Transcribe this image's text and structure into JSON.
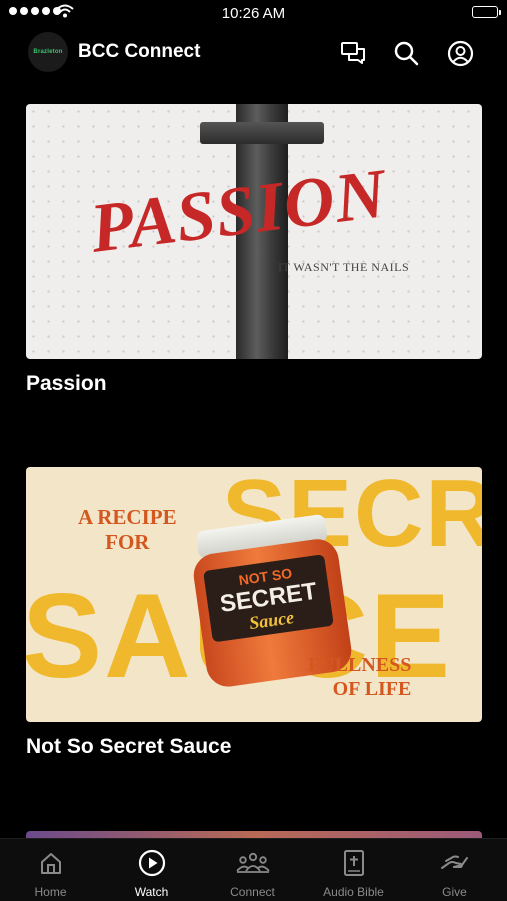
{
  "status_bar": {
    "time": "10:26 AM"
  },
  "header": {
    "app_title": "BCC Connect",
    "logo_text": "Brazleton"
  },
  "cards": [
    {
      "title": "Passion",
      "thumb_word": "PASSION",
      "thumb_subtitle": "IT WASN'T THE NAILS"
    },
    {
      "title": "Not So Secret Sauce",
      "thumb_line1": "A RECIPE",
      "thumb_line2": "FOR",
      "thumb_line3": "FULLNESS",
      "thumb_line4": "OF LIFE",
      "jar_line1": "NOT SO",
      "jar_line2": "SECRET",
      "jar_line3": "Sauce",
      "bg_word1": "SECRET",
      "bg_word2": "SAUCE"
    }
  ],
  "tabs": [
    {
      "label": "Home",
      "icon": "home-icon"
    },
    {
      "label": "Watch",
      "icon": "play-icon"
    },
    {
      "label": "Connect",
      "icon": "people-icon"
    },
    {
      "label": "Audio Bible",
      "icon": "bible-icon"
    },
    {
      "label": "Give",
      "icon": "give-icon"
    }
  ],
  "colors": {
    "accent_active": "#ffffff",
    "inactive": "#8a8a8a",
    "passion_red": "#c62828",
    "sauce_orange": "#d4571f"
  }
}
